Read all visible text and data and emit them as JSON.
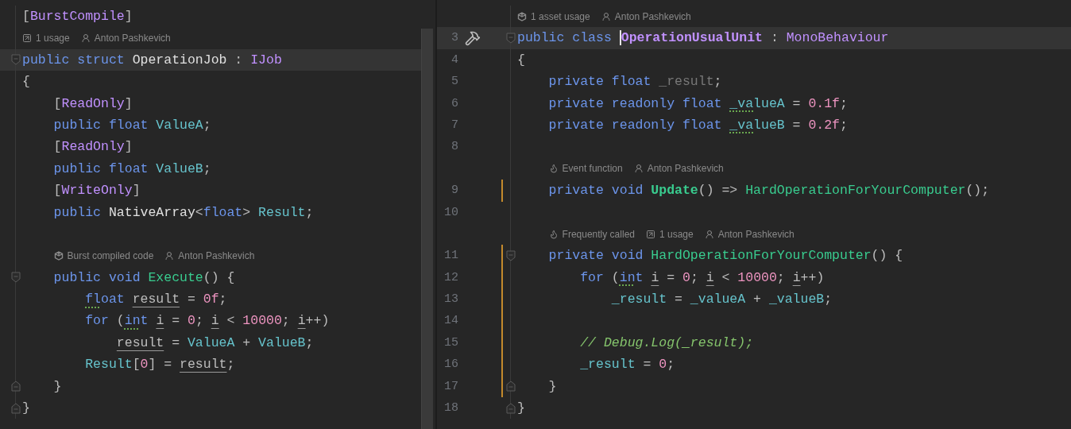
{
  "panes": [
    {
      "lines": [
        {
          "kind": "code",
          "current": false,
          "tokens": [
            {
              "t": "[",
              "kind": "p"
            },
            {
              "t": "BurstCompile",
              "kind": "class"
            },
            {
              "t": "]",
              "kind": "p"
            }
          ]
        },
        {
          "kind": "hints",
          "hints": [
            {
              "kind": "usage",
              "text": "1 usage"
            },
            {
              "kind": "author",
              "text": "Anton Pashkevich"
            }
          ]
        },
        {
          "kind": "code",
          "current": true,
          "fold_start": true,
          "tokens": [
            {
              "t": "public struct ",
              "kind": "kw"
            },
            {
              "t": "OperationJob",
              "kind": "type"
            },
            {
              "t": " : ",
              "kind": "p"
            },
            {
              "t": "IJob",
              "kind": "class"
            }
          ]
        },
        {
          "kind": "code",
          "current": false,
          "tokens": [
            {
              "t": "{",
              "kind": "p"
            }
          ]
        },
        {
          "kind": "code",
          "current": false,
          "tokens": [
            {
              "t": "    [",
              "kind": "p"
            },
            {
              "t": "ReadOnly",
              "kind": "class"
            },
            {
              "t": "]",
              "kind": "p"
            }
          ]
        },
        {
          "kind": "code",
          "current": false,
          "tokens": [
            {
              "t": "    public float ",
              "kind": "kw"
            },
            {
              "t": "ValueA",
              "kind": "field"
            },
            {
              "t": ";",
              "kind": "p"
            }
          ]
        },
        {
          "kind": "code",
          "current": false,
          "tokens": [
            {
              "t": "    [",
              "kind": "p"
            },
            {
              "t": "ReadOnly",
              "kind": "class"
            },
            {
              "t": "]",
              "kind": "p"
            }
          ]
        },
        {
          "kind": "code",
          "current": false,
          "tokens": [
            {
              "t": "    public float ",
              "kind": "kw"
            },
            {
              "t": "ValueB",
              "kind": "field"
            },
            {
              "t": ";",
              "kind": "p"
            }
          ]
        },
        {
          "kind": "code",
          "current": false,
          "tokens": [
            {
              "t": "    [",
              "kind": "p"
            },
            {
              "t": "WriteOnly",
              "kind": "class"
            },
            {
              "t": "]",
              "kind": "p"
            }
          ]
        },
        {
          "kind": "code",
          "current": false,
          "tokens": [
            {
              "t": "    public ",
              "kind": "kw"
            },
            {
              "t": "NativeArray",
              "kind": "type"
            },
            {
              "t": "<",
              "kind": "p"
            },
            {
              "t": "float",
              "kind": "kw"
            },
            {
              "t": "> ",
              "kind": "p"
            },
            {
              "t": "Result",
              "kind": "field"
            },
            {
              "t": ";",
              "kind": "p"
            }
          ]
        },
        {
          "kind": "code",
          "current": false
        },
        {
          "kind": "hints",
          "hints": [
            {
              "kind": "burst",
              "text": "Burst compiled code"
            },
            {
              "kind": "author",
              "text": "Anton Pashkevich"
            }
          ]
        },
        {
          "kind": "code",
          "current": false,
          "fold_start": true,
          "tokens": [
            {
              "t": "    public void ",
              "kind": "kw"
            },
            {
              "t": "Execute",
              "kind": "method"
            },
            {
              "t": "() {",
              "kind": "p"
            }
          ]
        },
        {
          "kind": "code",
          "current": false,
          "tokens": [
            {
              "t": "        fl",
              "kind": "kw",
              "dotted_underline": true
            },
            {
              "t": "oat ",
              "kind": "kw"
            },
            {
              "t": "result",
              "kind": "local",
              "underline": true
            },
            {
              "t": " = ",
              "kind": "p"
            },
            {
              "t": "0f",
              "kind": "num"
            },
            {
              "t": ";",
              "kind": "p"
            }
          ]
        },
        {
          "kind": "code",
          "current": false,
          "tokens": [
            {
              "t": "        for",
              "kind": "kw"
            },
            {
              "t": " (",
              "kind": "p"
            },
            {
              "t": "in",
              "kind": "kw",
              "dotted_underline": true
            },
            {
              "t": "t ",
              "kind": "kw"
            },
            {
              "t": "i",
              "kind": "local",
              "underline": true
            },
            {
              "t": " = ",
              "kind": "p"
            },
            {
              "t": "0",
              "kind": "num"
            },
            {
              "t": "; ",
              "kind": "p"
            },
            {
              "t": "i",
              "kind": "local",
              "underline": true
            },
            {
              "t": " < ",
              "kind": "p"
            },
            {
              "t": "10000",
              "kind": "num"
            },
            {
              "t": "; ",
              "kind": "p"
            },
            {
              "t": "i",
              "kind": "local",
              "underline": true
            },
            {
              "t": "++)",
              "kind": "p"
            }
          ]
        },
        {
          "kind": "code",
          "current": false,
          "tokens": [
            {
              "t": "            result",
              "kind": "local",
              "underline": true
            },
            {
              "t": " = ",
              "kind": "p"
            },
            {
              "t": "ValueA",
              "kind": "field"
            },
            {
              "t": " + ",
              "kind": "p"
            },
            {
              "t": "ValueB",
              "kind": "field"
            },
            {
              "t": ";",
              "kind": "p"
            }
          ]
        },
        {
          "kind": "code",
          "current": false,
          "tokens": [
            {
              "t": "        Result",
              "kind": "field"
            },
            {
              "t": "[",
              "kind": "p"
            },
            {
              "t": "0",
              "kind": "num"
            },
            {
              "t": "] = ",
              "kind": "p"
            },
            {
              "t": "result",
              "kind": "local",
              "underline": true
            },
            {
              "t": ";",
              "kind": "p"
            }
          ]
        },
        {
          "kind": "code",
          "current": false,
          "fold_end": true,
          "tokens": [
            {
              "t": "    }",
              "kind": "p"
            }
          ]
        },
        {
          "kind": "code",
          "current": false,
          "fold_end": true,
          "tokens": [
            {
              "t": "}",
              "kind": "p"
            }
          ]
        }
      ]
    },
    {
      "lines": [
        {
          "kind": "hints",
          "hints": [
            {
              "kind": "burst",
              "text": "1 asset usage"
            },
            {
              "kind": "author",
              "text": "Anton Pashkevich"
            }
          ]
        },
        {
          "kind": "code",
          "number": "3",
          "current": true,
          "changed": false,
          "hammer": true,
          "fold_start": true,
          "tokens": [
            {
              "t": "public class ",
              "kind": "kw"
            },
            {
              "t": "OperationUsualUnit",
              "kind": "class",
              "bold": true,
              "caret": true
            },
            {
              "t": " : ",
              "kind": "p"
            },
            {
              "t": "MonoBehaviour",
              "kind": "class"
            }
          ]
        },
        {
          "kind": "code",
          "number": "4",
          "current": false,
          "changed": false,
          "tokens": [
            {
              "t": "{",
              "kind": "p"
            }
          ]
        },
        {
          "kind": "code",
          "number": "5",
          "current": false,
          "changed": false,
          "tokens": [
            {
              "t": "    private float ",
              "kind": "kw"
            },
            {
              "t": "_result",
              "kind": "unused"
            },
            {
              "t": ";",
              "kind": "p"
            }
          ]
        },
        {
          "kind": "code",
          "number": "6",
          "current": false,
          "changed": false,
          "tokens": [
            {
              "t": "    private readonly float ",
              "kind": "kw"
            },
            {
              "t": "_va",
              "kind": "field",
              "dotted_underline": true
            },
            {
              "t": "lueA",
              "kind": "field"
            },
            {
              "t": " = ",
              "kind": "p"
            },
            {
              "t": "0.1f",
              "kind": "num"
            },
            {
              "t": ";",
              "kind": "p"
            }
          ]
        },
        {
          "kind": "code",
          "number": "7",
          "current": false,
          "changed": false,
          "tokens": [
            {
              "t": "    private readonly float ",
              "kind": "kw"
            },
            {
              "t": "_va",
              "kind": "field",
              "dotted_underline": true
            },
            {
              "t": "lueB",
              "kind": "field"
            },
            {
              "t": " = ",
              "kind": "p"
            },
            {
              "t": "0.2f",
              "kind": "num"
            },
            {
              "t": ";",
              "kind": "p"
            }
          ]
        },
        {
          "kind": "code",
          "number": "8",
          "current": false,
          "changed": false
        },
        {
          "kind": "hints",
          "hints": [
            {
              "kind": "flame",
              "text": "Event function"
            },
            {
              "kind": "author",
              "text": "Anton Pashkevich"
            }
          ]
        },
        {
          "kind": "code",
          "number": "9",
          "current": false,
          "changed": true,
          "tokens": [
            {
              "t": "    private void ",
              "kind": "kw"
            },
            {
              "t": "Update",
              "kind": "method",
              "bold": true
            },
            {
              "t": "() => ",
              "kind": "p"
            },
            {
              "t": "HardOperationForYourComputer",
              "kind": "method"
            },
            {
              "t": "();",
              "kind": "p"
            }
          ]
        },
        {
          "kind": "code",
          "number": "10",
          "current": false,
          "changed": false
        },
        {
          "kind": "hints",
          "hints": [
            {
              "kind": "flame",
              "text": "Frequently called"
            },
            {
              "kind": "usage",
              "text": "1 usage"
            },
            {
              "kind": "author",
              "text": "Anton Pashkevich"
            }
          ]
        },
        {
          "kind": "code",
          "number": "11",
          "current": false,
          "changed": true,
          "fold_start": true,
          "tokens": [
            {
              "t": "    private void ",
              "kind": "kw"
            },
            {
              "t": "HardOperationForYourComputer",
              "kind": "method"
            },
            {
              "t": "() {",
              "kind": "p"
            }
          ]
        },
        {
          "kind": "code",
          "number": "12",
          "current": false,
          "changed": true,
          "tokens": [
            {
              "t": "        for",
              "kind": "kw"
            },
            {
              "t": " (",
              "kind": "p"
            },
            {
              "t": "in",
              "kind": "kw",
              "dotted_underline": true
            },
            {
              "t": "t ",
              "kind": "kw"
            },
            {
              "t": "i",
              "kind": "local",
              "underline": true
            },
            {
              "t": " = ",
              "kind": "p"
            },
            {
              "t": "0",
              "kind": "num"
            },
            {
              "t": "; ",
              "kind": "p"
            },
            {
              "t": "i",
              "kind": "local",
              "underline": true
            },
            {
              "t": " < ",
              "kind": "p"
            },
            {
              "t": "10000",
              "kind": "num"
            },
            {
              "t": "; ",
              "kind": "p"
            },
            {
              "t": "i",
              "kind": "local",
              "underline": true
            },
            {
              "t": "++)",
              "kind": "p"
            }
          ]
        },
        {
          "kind": "code",
          "number": "13",
          "current": false,
          "changed": true,
          "tokens": [
            {
              "t": "            _result",
              "kind": "field"
            },
            {
              "t": " = ",
              "kind": "p"
            },
            {
              "t": "_valueA",
              "kind": "field"
            },
            {
              "t": " + ",
              "kind": "p"
            },
            {
              "t": "_valueB",
              "kind": "field"
            },
            {
              "t": ";",
              "kind": "p"
            }
          ]
        },
        {
          "kind": "code",
          "number": "14",
          "current": false,
          "changed": true
        },
        {
          "kind": "code",
          "number": "15",
          "current": false,
          "changed": true,
          "tokens": [
            {
              "t": "        // Debug.Log(_result);",
              "kind": "comment"
            }
          ]
        },
        {
          "kind": "code",
          "number": "16",
          "current": false,
          "changed": true,
          "tokens": [
            {
              "t": "        _result",
              "kind": "field"
            },
            {
              "t": " = ",
              "kind": "p"
            },
            {
              "t": "0",
              "kind": "num"
            },
            {
              "t": ";",
              "kind": "p"
            }
          ]
        },
        {
          "kind": "code",
          "number": "17",
          "current": false,
          "changed": true,
          "fold_end": true,
          "tokens": [
            {
              "t": "    }",
              "kind": "p"
            }
          ]
        },
        {
          "kind": "code",
          "number": "18",
          "current": false,
          "changed": false,
          "fold_end": true,
          "tokens": [
            {
              "t": "}",
              "kind": "p"
            }
          ]
        }
      ]
    }
  ]
}
